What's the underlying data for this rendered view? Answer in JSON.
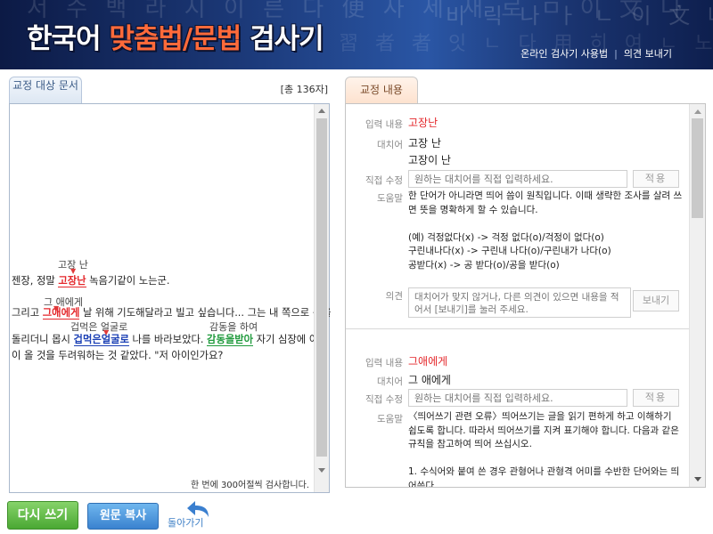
{
  "header": {
    "title_main": "한국어",
    "title_accent": "맞춤법/문법",
    "title_end": "검사기",
    "deco_row1": "서 수 백 라 시 이 른 다 便 사 세 새 로 ㅁ 이 文 나",
    "deco_row2": "習 者 者 잇 ㄴ 다 用 히 여 ㄴ 노 ㄴ 다 세 새 로",
    "deco_row3": "비 릭 나 ㅏ ㄴ 이 文 나",
    "links": [
      {
        "label": "온라인 검사기 사용법"
      },
      {
        "label": "의견 보내기"
      }
    ]
  },
  "left": {
    "tab_label": "교정 대상 문서",
    "char_count": "[총 136자]",
    "footer": "한 번에 300어절씩 검사합니다.",
    "lines": [
      {
        "pre": "젠장, 정말 ",
        "err": "고장난",
        "post": " 녹음기같이 노는군.",
        "suggestion": "고장 난"
      },
      {
        "pre": "그리고 ",
        "err": "그애에게",
        "post": " 날 위해 기도해달라고 빌고 싶습니다... 그는 내 쪽으로 몸을",
        "suggestion": "그 애에게"
      },
      {
        "pre": "돌리더니 몹시 ",
        "err": "겁먹은얼굴로",
        "mid": " 나를 바라보았다. ",
        "err2": "감동을받아",
        "post": " 자기 심장에 이상",
        "suggestion": "겁먹은 얼굴로",
        "suggestion2": "감동을 하여"
      },
      {
        "pre": "이 올 것을 두려워하는 것 같았다. \"저 아이인가요?"
      }
    ]
  },
  "right": {
    "tab_label": "교정 내용",
    "labels": {
      "input": "입력 내용",
      "replacement": "대치어",
      "direct_edit": "직접 수정",
      "help": "도움말",
      "opinion": "의견"
    },
    "direct_placeholder": "원하는 대치어를 직접 입력하세요.",
    "apply_label": "적용",
    "opinion_placeholder": "대치어가 맞지 않거나, 다른 의견이 있으면 내용을 적어서 [보내기]를 눌러 주세요.",
    "send_label": "보내기",
    "results": [
      {
        "input": "고장난",
        "replacements": [
          "고장 난",
          "고장이 난"
        ],
        "help": "한 단어가 아니라면 띄어 씀이 원칙입니다. 이때 생략한 조사를 살려 쓰면 뜻을 명확하게 할 수 있습니다.\n\n(예) 걱정없다(x) -> 걱정 없다(o)/걱정이 없다(o)\n구린내나다(x) -> 구린내 나다(o)/구린내가 나다(o)\n공받다(x) -> 공 받다(o)/공을 받다(o)"
      },
      {
        "input": "그애에게",
        "replacements": [
          "그 애에게"
        ],
        "help": "〈띄어쓰기 관련 오류〉띄어쓰기는 글을 읽기 편하게 하고 이해하기 쉽도록 합니다. 따라서 띄어쓰기를 지켜 표기해야 합니다. 다음과 같은 규칙을 참고하여 띄어 쓰십시오.\n\n1. 수식어와 붙여 쓴 경우 관형어나 관형격 어미를 수반한 단어와는 띄어쓴다."
      }
    ]
  },
  "bottom": {
    "rewrite_label": "다시 쓰기",
    "copy_label": "원문 복사",
    "back_label": "돌아가기"
  },
  "colors": {
    "error_red": "#e4262a",
    "error_blue": "#1a3fb4",
    "error_green": "#1f9a3c",
    "rewrite_green": "#4aa833",
    "copy_blue": "#3a82cf"
  }
}
